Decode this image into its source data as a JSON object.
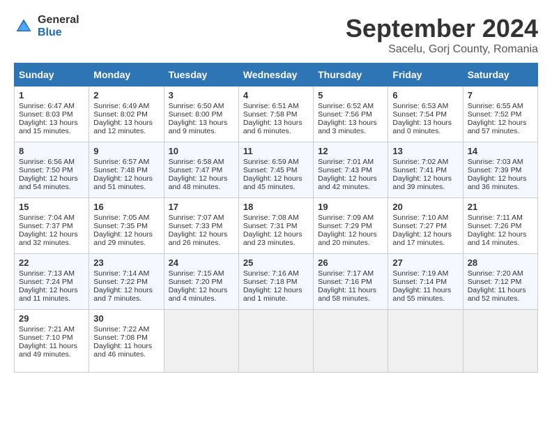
{
  "header": {
    "logo_general": "General",
    "logo_blue": "Blue",
    "month_title": "September 2024",
    "location": "Sacelu, Gorj County, Romania"
  },
  "calendar": {
    "days_of_week": [
      "Sunday",
      "Monday",
      "Tuesday",
      "Wednesday",
      "Thursday",
      "Friday",
      "Saturday"
    ],
    "weeks": [
      [
        {
          "day": "1",
          "sunrise": "6:47 AM",
          "sunset": "8:03 PM",
          "daylight": "13 hours and 15 minutes."
        },
        {
          "day": "2",
          "sunrise": "6:49 AM",
          "sunset": "8:02 PM",
          "daylight": "13 hours and 12 minutes."
        },
        {
          "day": "3",
          "sunrise": "6:50 AM",
          "sunset": "8:00 PM",
          "daylight": "13 hours and 9 minutes."
        },
        {
          "day": "4",
          "sunrise": "6:51 AM",
          "sunset": "7:58 PM",
          "daylight": "13 hours and 6 minutes."
        },
        {
          "day": "5",
          "sunrise": "6:52 AM",
          "sunset": "7:56 PM",
          "daylight": "13 hours and 3 minutes."
        },
        {
          "day": "6",
          "sunrise": "6:53 AM",
          "sunset": "7:54 PM",
          "daylight": "13 hours and 0 minutes."
        },
        {
          "day": "7",
          "sunrise": "6:55 AM",
          "sunset": "7:52 PM",
          "daylight": "12 hours and 57 minutes."
        }
      ],
      [
        {
          "day": "8",
          "sunrise": "6:56 AM",
          "sunset": "7:50 PM",
          "daylight": "12 hours and 54 minutes."
        },
        {
          "day": "9",
          "sunrise": "6:57 AM",
          "sunset": "7:48 PM",
          "daylight": "12 hours and 51 minutes."
        },
        {
          "day": "10",
          "sunrise": "6:58 AM",
          "sunset": "7:47 PM",
          "daylight": "12 hours and 48 minutes."
        },
        {
          "day": "11",
          "sunrise": "6:59 AM",
          "sunset": "7:45 PM",
          "daylight": "12 hours and 45 minutes."
        },
        {
          "day": "12",
          "sunrise": "7:01 AM",
          "sunset": "7:43 PM",
          "daylight": "12 hours and 42 minutes."
        },
        {
          "day": "13",
          "sunrise": "7:02 AM",
          "sunset": "7:41 PM",
          "daylight": "12 hours and 39 minutes."
        },
        {
          "day": "14",
          "sunrise": "7:03 AM",
          "sunset": "7:39 PM",
          "daylight": "12 hours and 36 minutes."
        }
      ],
      [
        {
          "day": "15",
          "sunrise": "7:04 AM",
          "sunset": "7:37 PM",
          "daylight": "12 hours and 32 minutes."
        },
        {
          "day": "16",
          "sunrise": "7:05 AM",
          "sunset": "7:35 PM",
          "daylight": "12 hours and 29 minutes."
        },
        {
          "day": "17",
          "sunrise": "7:07 AM",
          "sunset": "7:33 PM",
          "daylight": "12 hours and 26 minutes."
        },
        {
          "day": "18",
          "sunrise": "7:08 AM",
          "sunset": "7:31 PM",
          "daylight": "12 hours and 23 minutes."
        },
        {
          "day": "19",
          "sunrise": "7:09 AM",
          "sunset": "7:29 PM",
          "daylight": "12 hours and 20 minutes."
        },
        {
          "day": "20",
          "sunrise": "7:10 AM",
          "sunset": "7:27 PM",
          "daylight": "12 hours and 17 minutes."
        },
        {
          "day": "21",
          "sunrise": "7:11 AM",
          "sunset": "7:26 PM",
          "daylight": "12 hours and 14 minutes."
        }
      ],
      [
        {
          "day": "22",
          "sunrise": "7:13 AM",
          "sunset": "7:24 PM",
          "daylight": "12 hours and 11 minutes."
        },
        {
          "day": "23",
          "sunrise": "7:14 AM",
          "sunset": "7:22 PM",
          "daylight": "12 hours and 7 minutes."
        },
        {
          "day": "24",
          "sunrise": "7:15 AM",
          "sunset": "7:20 PM",
          "daylight": "12 hours and 4 minutes."
        },
        {
          "day": "25",
          "sunrise": "7:16 AM",
          "sunset": "7:18 PM",
          "daylight": "12 hours and 1 minute."
        },
        {
          "day": "26",
          "sunrise": "7:17 AM",
          "sunset": "7:16 PM",
          "daylight": "11 hours and 58 minutes."
        },
        {
          "day": "27",
          "sunrise": "7:19 AM",
          "sunset": "7:14 PM",
          "daylight": "11 hours and 55 minutes."
        },
        {
          "day": "28",
          "sunrise": "7:20 AM",
          "sunset": "7:12 PM",
          "daylight": "11 hours and 52 minutes."
        }
      ],
      [
        {
          "day": "29",
          "sunrise": "7:21 AM",
          "sunset": "7:10 PM",
          "daylight": "11 hours and 49 minutes."
        },
        {
          "day": "30",
          "sunrise": "7:22 AM",
          "sunset": "7:08 PM",
          "daylight": "11 hours and 46 minutes."
        },
        null,
        null,
        null,
        null,
        null
      ]
    ]
  }
}
